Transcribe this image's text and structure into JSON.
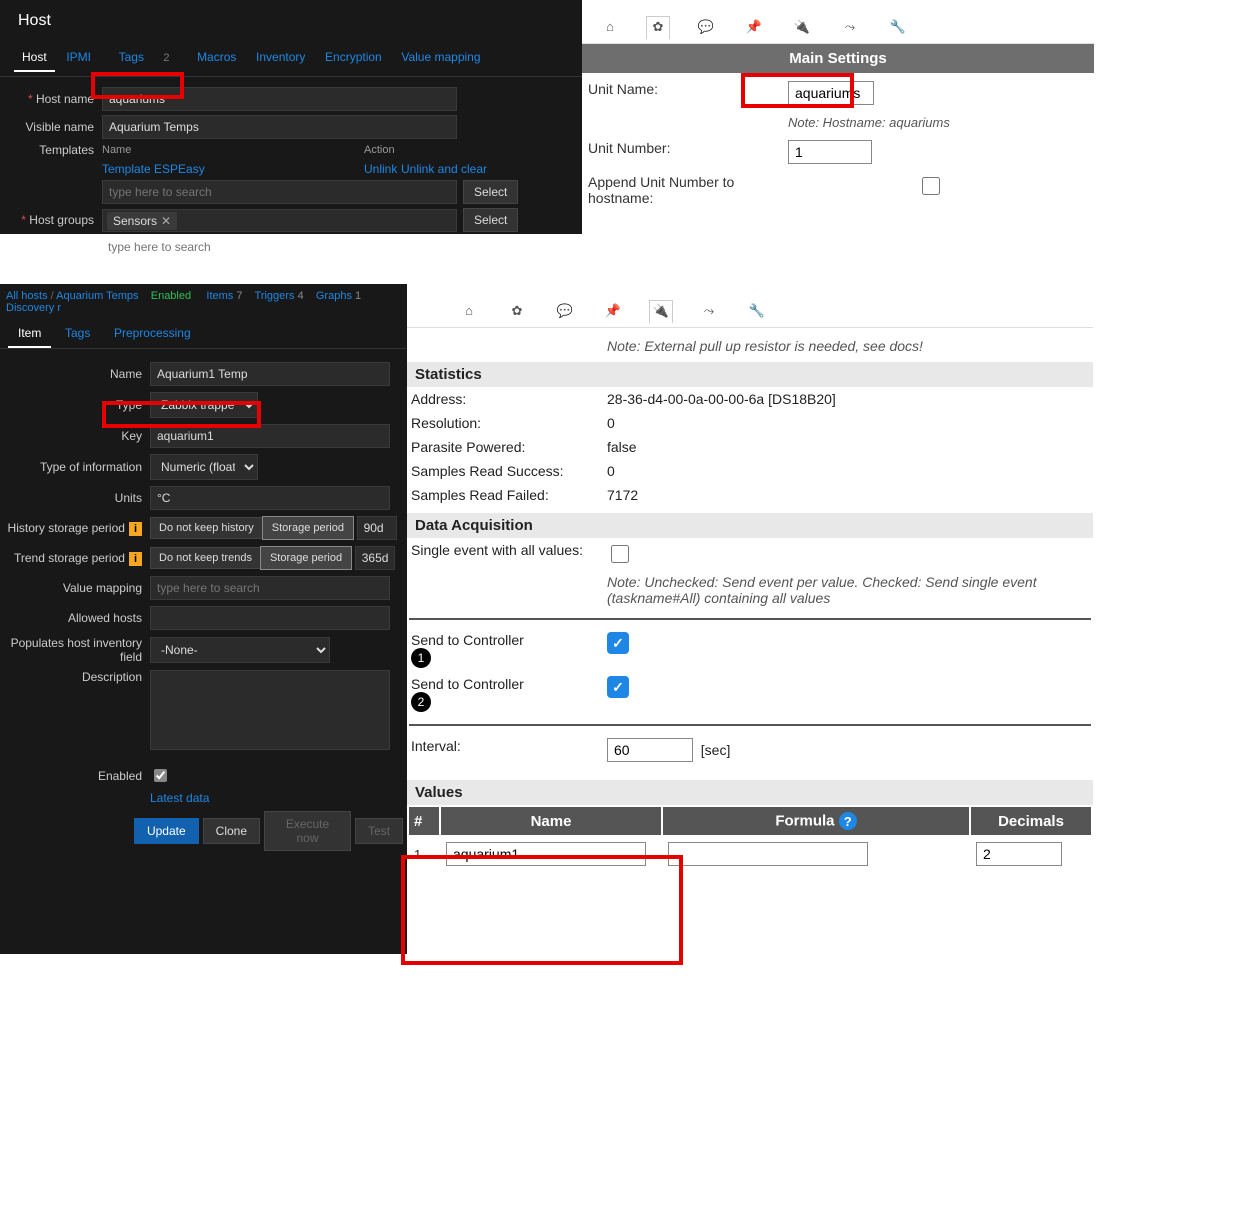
{
  "panel1": {
    "title": "Host",
    "tabs": {
      "host": "Host",
      "ipmi": "IPMI",
      "tags": "Tags",
      "tags_count": "2",
      "macros": "Macros",
      "inventory": "Inventory",
      "encryption": "Encryption",
      "valuemap": "Value mapping"
    },
    "labels": {
      "hostname": "Host name",
      "visiblename": "Visible name",
      "templates": "Templates",
      "hostgroups": "Host groups"
    },
    "hostname": "aquariums",
    "visiblename": "Aquarium Temps",
    "tmpl_head_name": "Name",
    "tmpl_head_action": "Action",
    "template_link": "Template ESPEasy",
    "unlink": "Unlink",
    "unlink_clear": "Unlink and clear",
    "search_placeholder": "type here to search",
    "select_btn": "Select",
    "group_tag": "Sensors"
  },
  "panel2": {
    "section": "Main Settings",
    "labels": {
      "unitname": "Unit Name:",
      "unitnum": "Unit Number:",
      "append": "Append Unit Number to hostname:"
    },
    "unitname": "aquariums",
    "note": "Note: Hostname: aquariums",
    "unitnum": "1"
  },
  "panel3": {
    "crumbs": {
      "allhosts": "All hosts",
      "host": "Aquarium Temps",
      "enabled": "Enabled",
      "items": "Items",
      "items_c": "7",
      "triggers": "Triggers",
      "triggers_c": "4",
      "graphs": "Graphs",
      "graphs_c": "1",
      "discovery": "Discovery r"
    },
    "tabs": {
      "item": "Item",
      "tags": "Tags",
      "preproc": "Preprocessing"
    },
    "labels": {
      "name": "Name",
      "type": "Type",
      "key": "Key",
      "toi": "Type of information",
      "units": "Units",
      "history": "History storage period",
      "trend": "Trend storage period",
      "valuemap": "Value mapping",
      "allowed": "Allowed hosts",
      "populates": "Populates host inventory field",
      "desc": "Description",
      "enabled": "Enabled"
    },
    "name": "Aquarium1 Temp",
    "type": "Zabbix trapper",
    "key": "aquarium1",
    "toi": "Numeric (float)",
    "units": "°C",
    "radio_nohist": "Do not keep history",
    "radio_storage": "Storage period",
    "hist_val": "90d",
    "radio_notrend": "Do not keep trends",
    "trend_val": "365d",
    "valuemap_ph": "type here to search",
    "none": "-None-",
    "latest": "Latest data",
    "btn_update": "Update",
    "btn_clone": "Clone",
    "btn_exec": "Execute now",
    "btn_test": "Test"
  },
  "panel4": {
    "note": "Note: External pull up resistor is needed, see docs!",
    "sect_stats": "Statistics",
    "stats": {
      "addr_l": "Address:",
      "addr_v": "28-36-d4-00-0a-00-00-6a [DS18B20]",
      "res_l": "Resolution:",
      "res_v": "0",
      "par_l": "Parasite Powered:",
      "par_v": "false",
      "succ_l": "Samples Read Success:",
      "succ_v": "0",
      "fail_l": "Samples Read Failed:",
      "fail_v": "7172"
    },
    "sect_data": "Data Acquisition",
    "single_l": "Single event with all values:",
    "single_note": "Note: Unchecked: Send event per value. Checked: Send single event (taskname#All) containing all values",
    "sendctrl": "Send to Controller",
    "interval_l": "Interval:",
    "interval_v": "60",
    "sec": "[sec]",
    "sect_values": "Values",
    "th_num": "#",
    "th_name": "Name",
    "th_formula": "Formula",
    "th_dec": "Decimals",
    "row1_num": "1",
    "row1_name": "aquarium1",
    "row1_dec": "2"
  }
}
